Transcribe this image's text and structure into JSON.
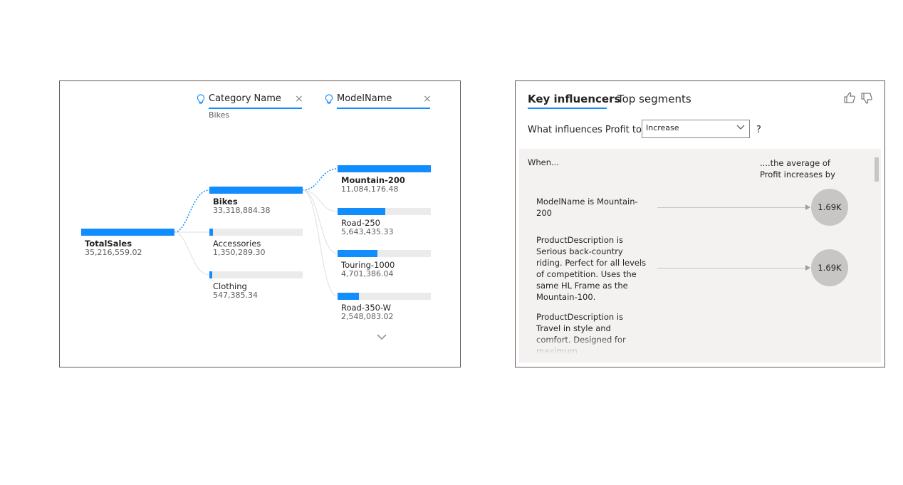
{
  "decomposition_tree": {
    "levels": [
      {
        "title": "Category Name",
        "selected": "Bikes",
        "close": "×"
      },
      {
        "title": "ModelName",
        "close": "×"
      }
    ],
    "root": {
      "label": "TotalSales",
      "value": "35,216,559.02",
      "fill": 1.0
    },
    "categories": [
      {
        "label": "Bikes",
        "value": "33,318,884.38",
        "fill": 1.0,
        "selected": true
      },
      {
        "label": "Accessories",
        "value": "1,350,289.30",
        "fill": 0.041
      },
      {
        "label": "Clothing",
        "value": "547,385.34",
        "fill": 0.017
      }
    ],
    "models": [
      {
        "label": "Mountain-200",
        "value": "11,084,176.48",
        "fill": 1.0,
        "selected": true
      },
      {
        "label": "Road-250",
        "value": "5,643,435.33",
        "fill": 0.509
      },
      {
        "label": "Touring-1000",
        "value": "4,701,386.04",
        "fill": 0.424
      },
      {
        "label": "Road-350-W",
        "value": "2,548,083.02",
        "fill": 0.23
      }
    ],
    "more_icon": "chevron-down-icon"
  },
  "key_influencers": {
    "tabs": [
      {
        "label": "Key influencers",
        "active": true
      },
      {
        "label": "Top segments",
        "active": false
      }
    ],
    "question": "What influences Profit to",
    "dropdown_value": "Increase",
    "help": "?",
    "col_when": "When...",
    "col_effect": "....the average of Profit increases by",
    "influencers": [
      {
        "text": "ModelName is Mountain-200",
        "value": "1.69K"
      },
      {
        "text": "ProductDescription is Serious back-country riding. Perfect for all levels of competition. Uses the same HL Frame as the Mountain-100.",
        "value": "1.69K"
      },
      {
        "text": "ProductDescription is Travel in style and comfort. Designed for maximum",
        "value": ""
      }
    ],
    "icons": {
      "like": "thumbs-up-icon",
      "dislike": "thumbs-down-icon"
    },
    "accent": "#118dff"
  }
}
